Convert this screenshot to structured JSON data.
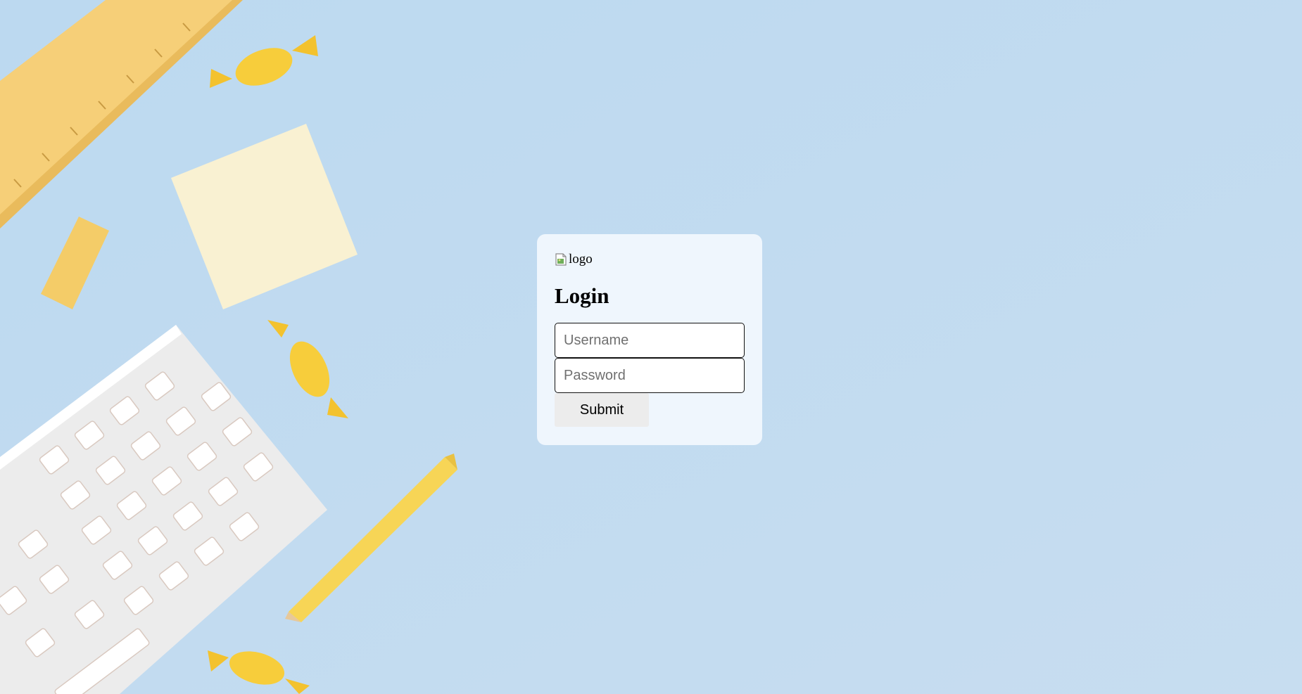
{
  "login": {
    "logo_alt": "logo",
    "title": "Login",
    "username_placeholder": "Username",
    "password_placeholder": "Password",
    "submit_label": "Submit"
  },
  "background": {
    "image": "desk-flatlay-photo",
    "color": "#c3dcf0"
  }
}
